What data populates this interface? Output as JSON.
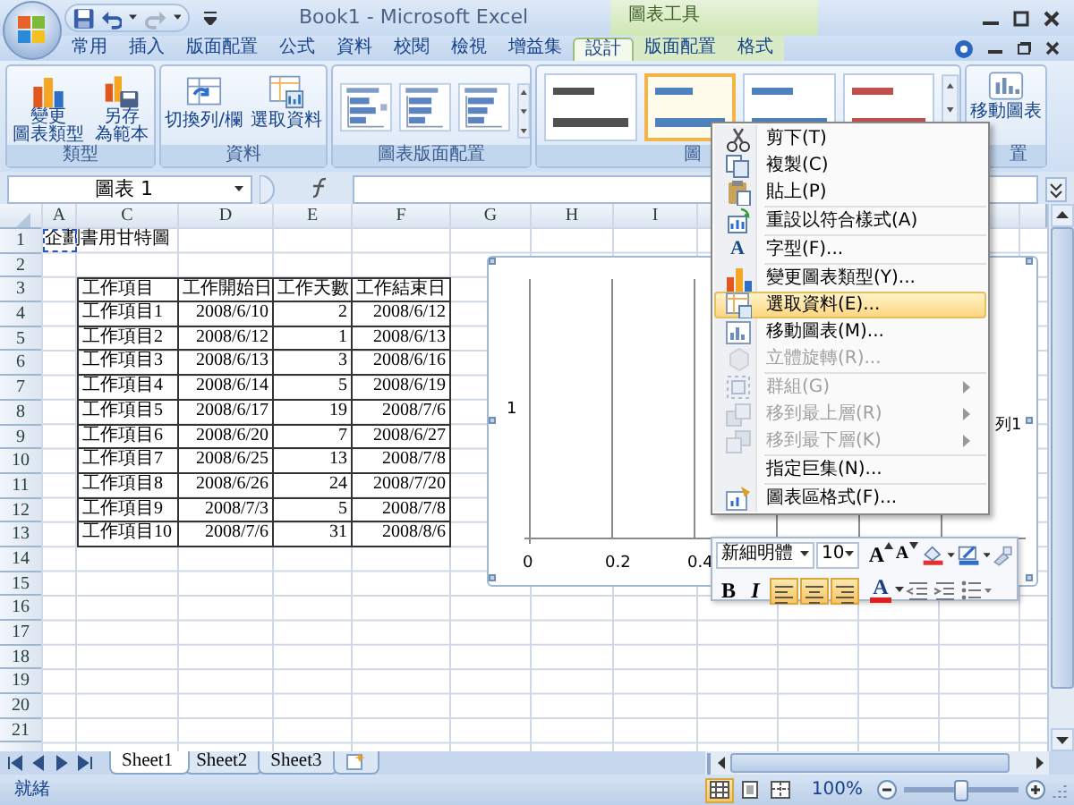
{
  "window": {
    "title": "Book1 - Microsoft Excel",
    "context_tab_title": "圖表工具"
  },
  "tabs": [
    {
      "label": "常用",
      "selected": false,
      "context": false
    },
    {
      "label": "插入",
      "selected": false,
      "context": false
    },
    {
      "label": "版面配置",
      "selected": false,
      "context": false
    },
    {
      "label": "公式",
      "selected": false,
      "context": false
    },
    {
      "label": "資料",
      "selected": false,
      "context": false
    },
    {
      "label": "校閱",
      "selected": false,
      "context": false
    },
    {
      "label": "檢視",
      "selected": false,
      "context": false
    },
    {
      "label": "增益集",
      "selected": false,
      "context": false
    },
    {
      "label": "設計",
      "selected": true,
      "context": true
    },
    {
      "label": "版面配置",
      "selected": false,
      "context": true
    },
    {
      "label": "格式",
      "selected": false,
      "context": true
    }
  ],
  "ribbon": {
    "groups": [
      {
        "kind": "large",
        "label": "類型",
        "buttons": [
          [
            "變更",
            "圖表類型"
          ],
          [
            "另存",
            "為範本"
          ]
        ]
      },
      {
        "kind": "small",
        "label": "資料",
        "buttons": [
          "切換列/欄",
          "選取資料"
        ]
      },
      {
        "kind": "layouts",
        "label": "圖表版面配置"
      },
      {
        "kind": "styles",
        "label": "圖",
        "styles": [
          {
            "color": "#505050",
            "selected": false
          },
          {
            "color": "#4f81bd",
            "selected": true
          },
          {
            "color": "#4f81bd",
            "selected": false
          },
          {
            "color": "#c0504d",
            "selected": false
          }
        ]
      },
      {
        "kind": "location",
        "label": "置",
        "buttons": [
          "移動圖表"
        ]
      }
    ]
  },
  "name_box": "圖表 1",
  "sheet": {
    "columns": [
      "A",
      "C",
      "D",
      "E",
      "F",
      "G",
      "H",
      "I"
    ],
    "row_headers": [
      "1",
      "2",
      "3",
      "4",
      "5",
      "6",
      "7",
      "8",
      "9",
      "10",
      "11",
      "12",
      "13",
      "14",
      "15",
      "16",
      "17",
      "18",
      "19",
      "20",
      "21"
    ],
    "title_cell": {
      "text": "企劃書用甘特圖",
      "selected": true
    },
    "table": {
      "columns": [
        "工作項目",
        "工作開始日",
        "工作天數",
        "工作結束日"
      ],
      "rows": [
        [
          "工作項目1",
          "2008/6/10",
          "2",
          "2008/6/12"
        ],
        [
          "工作項目2",
          "2008/6/12",
          "1",
          "2008/6/13"
        ],
        [
          "工作項目3",
          "2008/6/13",
          "3",
          "2008/6/16"
        ],
        [
          "工作項目4",
          "2008/6/14",
          "5",
          "2008/6/19"
        ],
        [
          "工作項目5",
          "2008/6/17",
          "19",
          "2008/7/6"
        ],
        [
          "工作項目6",
          "2008/6/20",
          "7",
          "2008/6/27"
        ],
        [
          "工作項目7",
          "2008/6/25",
          "13",
          "2008/7/8"
        ],
        [
          "工作項目8",
          "2008/6/26",
          "24",
          "2008/7/20"
        ],
        [
          "工作項目9",
          "2008/7/3",
          "5",
          "2008/7/8"
        ],
        [
          "工作項目10",
          "2008/7/6",
          "31",
          "2008/8/6"
        ]
      ]
    }
  },
  "chart": {
    "selected": true,
    "y_label": "1",
    "x_ticks": [
      "0",
      "0.2",
      "0.4"
    ],
    "legend": "列1"
  },
  "context_menu": {
    "groups": [
      [
        {
          "label": "剪下(T)",
          "disabled": false,
          "submenu": false,
          "selected": false
        },
        {
          "label": "複製(C)",
          "disabled": false,
          "submenu": false,
          "selected": false
        },
        {
          "label": "貼上(P)",
          "disabled": false,
          "submenu": false,
          "selected": false
        }
      ],
      [
        {
          "label": "重設以符合樣式(A)",
          "disabled": false,
          "submenu": false,
          "selected": false
        }
      ],
      [
        {
          "label": "字型(F)...",
          "glyph": "A",
          "disabled": false,
          "submenu": false,
          "selected": false
        }
      ],
      [
        {
          "label": "變更圖表類型(Y)...",
          "disabled": false,
          "submenu": false,
          "selected": false
        },
        {
          "label": "選取資料(E)...",
          "disabled": false,
          "submenu": false,
          "selected": true
        },
        {
          "label": "移動圖表(M)...",
          "disabled": false,
          "submenu": false,
          "selected": false
        },
        {
          "label": "立體旋轉(R)...",
          "disabled": true,
          "submenu": false,
          "selected": false
        }
      ],
      [
        {
          "label": "群組(G)",
          "disabled": true,
          "submenu": true,
          "selected": false
        },
        {
          "label": "移到最上層(R)",
          "disabled": true,
          "submenu": true,
          "selected": false
        },
        {
          "label": "移到最下層(K)",
          "disabled": true,
          "submenu": true,
          "selected": false
        }
      ],
      [
        {
          "label": "指定巨集(N)...",
          "disabled": false,
          "submenu": false,
          "selected": false
        }
      ],
      [
        {
          "label": "圖表區格式(F)...",
          "disabled": false,
          "submenu": false,
          "selected": false
        }
      ]
    ]
  },
  "mini_toolbar": {
    "font": "新細明體",
    "size": "10",
    "grow": "A",
    "shrink": "A",
    "bold": "B",
    "italic": "I",
    "font_color": "A",
    "align": [
      {
        "selected": true
      },
      {
        "selected": true
      },
      {
        "selected": true
      }
    ]
  },
  "sheet_tabs": [
    {
      "label": "Sheet1",
      "selected": true
    },
    {
      "label": "Sheet2",
      "selected": false
    },
    {
      "label": "Sheet3",
      "selected": false
    }
  ],
  "status_bar": {
    "text": "就緒",
    "views": [
      {
        "selected": true
      },
      {
        "selected": false
      },
      {
        "selected": false
      }
    ],
    "zoom": "100%",
    "zoom_slider": {
      "level": 0.5
    }
  }
}
